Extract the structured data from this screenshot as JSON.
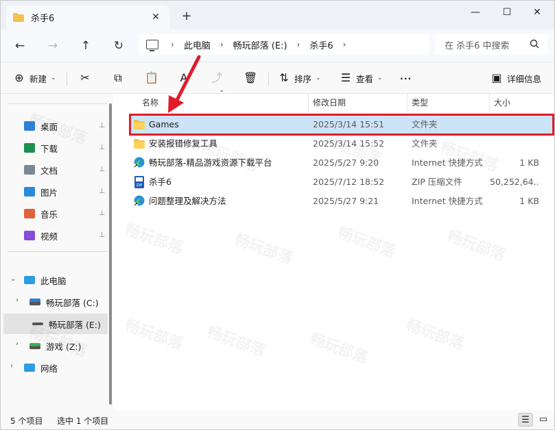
{
  "titlebar": {
    "tab_title": "杀手6",
    "close_tab_glyph": "✕",
    "new_tab_glyph": "+",
    "minimize_glyph": "—",
    "maximize_glyph": "☐",
    "close_glyph": "✕"
  },
  "nav": {
    "back_glyph": "←",
    "forward_glyph": "→",
    "up_glyph": "↑",
    "refresh_glyph": "↻",
    "breadcrumbs": [
      "此电脑",
      "畅玩部落 (E:)",
      "杀手6"
    ],
    "crumb_sep": "›",
    "search_placeholder": "在 杀手6 中搜索"
  },
  "toolbar": {
    "new_label": "新建",
    "sort_label": "排序",
    "view_label": "查看",
    "more_label": "···",
    "details_label": "详细信息"
  },
  "sidebar": {
    "quick": [
      {
        "label": "桌面",
        "icon": "desktop-icon",
        "color": "#2f7fd4"
      },
      {
        "label": "下载",
        "icon": "download-icon",
        "color": "#1f8f4f"
      },
      {
        "label": "文档",
        "icon": "document-icon",
        "color": "#7b8794"
      },
      {
        "label": "图片",
        "icon": "picture-icon",
        "color": "#2c89d9"
      },
      {
        "label": "音乐",
        "icon": "music-icon",
        "color": "#e0623a"
      },
      {
        "label": "视频",
        "icon": "video-icon",
        "color": "#8a4bd6"
      }
    ],
    "pin_glyph": "📌",
    "this_pc": "此电脑",
    "drives": [
      {
        "label": "畅玩部落 (C:)"
      },
      {
        "label": "畅玩部落 (E:)"
      },
      {
        "label": "游戏 (Z:)"
      }
    ],
    "network": "网络"
  },
  "columns": {
    "name": "名称",
    "date": "修改日期",
    "type": "类型",
    "size": "大小"
  },
  "files": [
    {
      "name": "Games",
      "date": "2025/3/14 15:51",
      "type": "文件夹",
      "size": "",
      "icon": "folder-icon"
    },
    {
      "name": "安装报错修复工具",
      "date": "2025/3/14 15:52",
      "type": "文件夹",
      "size": "",
      "icon": "folder-icon"
    },
    {
      "name": "畅玩部落-精品游戏资源下载平台",
      "date": "2025/5/27 9:20",
      "type": "Internet 快捷方式",
      "size": "1 KB",
      "icon": "edge-icon"
    },
    {
      "name": "杀手6",
      "date": "2025/7/12 18:52",
      "type": "ZIP 压缩文件",
      "size": "50,252,64...",
      "icon": "zip-icon"
    },
    {
      "name": "问题整理及解决方法",
      "date": "2025/5/27 9:21",
      "type": "Internet 快捷方式",
      "size": "1 KB",
      "icon": "edge-icon"
    }
  ],
  "status": {
    "item_count": "5 个项目",
    "selected_count": "选中 1 个项目"
  },
  "colors": {
    "accent": "#0067c0",
    "selection": "#cce4f7",
    "highlight_box": "#e21b2b",
    "folder": "#f4c04e"
  }
}
